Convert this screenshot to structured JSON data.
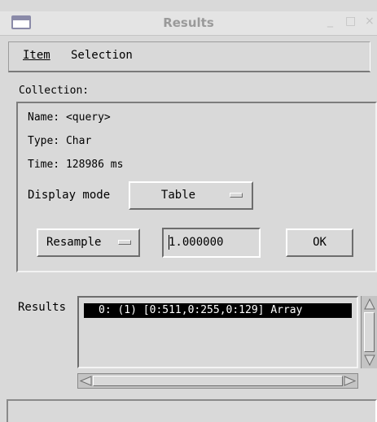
{
  "window": {
    "title": "Results",
    "minimize_glyph": "_",
    "maximize_glyph": "□",
    "close_glyph": "×"
  },
  "menubar": {
    "items": [
      {
        "label": "Item"
      },
      {
        "label": "Selection"
      }
    ]
  },
  "collection": {
    "label": "Collection:",
    "name": "Name: <query>",
    "type": "Type: Char",
    "time": "Time: 128986 ms",
    "display_mode_label": "Display mode",
    "display_mode_value": "Table"
  },
  "controls": {
    "resample_label": "Resample",
    "factor_value": "1.000000",
    "ok_label": "OK"
  },
  "results": {
    "label": "Results",
    "items": [
      "0: (1) [0:511,0:255,0:129] Array"
    ]
  },
  "icons": [
    "window-icon",
    "scroll-up-arrow-icon",
    "scroll-down-arrow-icon",
    "scroll-left-arrow-icon",
    "scroll-right-arrow-icon",
    "option-menu-indicator-icon"
  ]
}
